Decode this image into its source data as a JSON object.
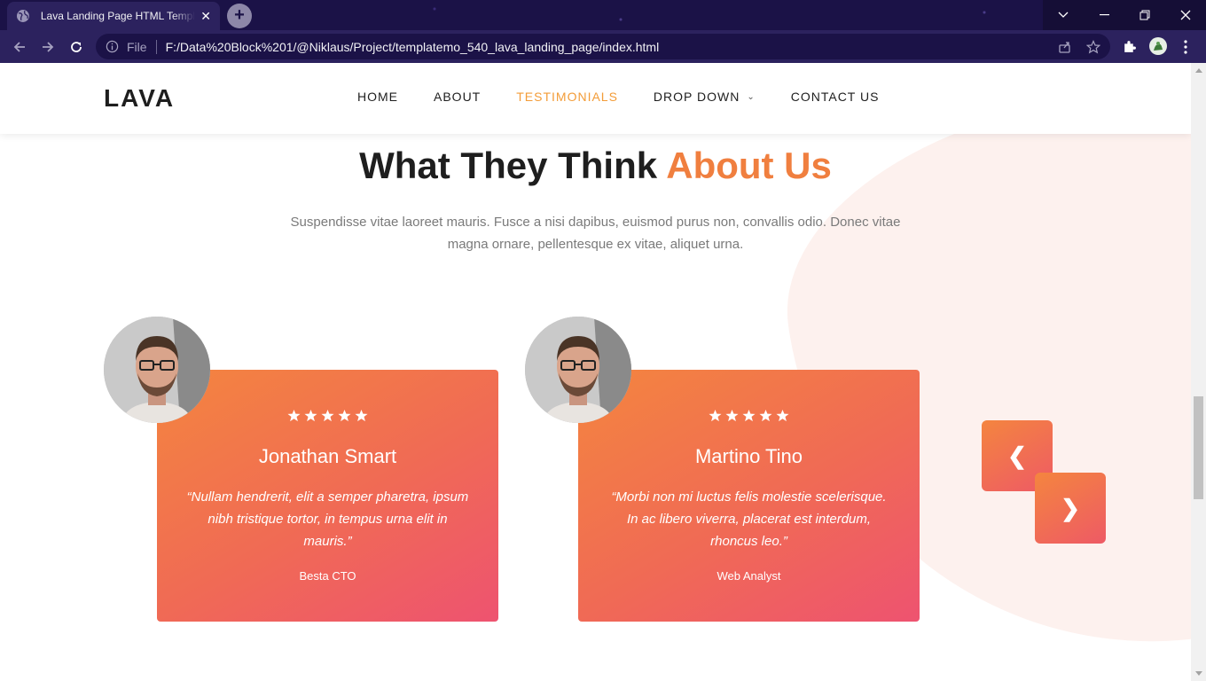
{
  "browser": {
    "tab_title": "Lava Landing Page HTML Template",
    "url_scheme_label": "File",
    "url": "F:/Data%20Block%201/@Niklaus/Project/templatemo_540_lava_landing_page/index.html"
  },
  "site": {
    "logo": "LAVA",
    "nav": [
      {
        "label": "HOME",
        "active": false
      },
      {
        "label": "ABOUT",
        "active": false
      },
      {
        "label": "TESTIMONIALS",
        "active": true
      },
      {
        "label": "DROP DOWN",
        "active": false,
        "has_dropdown": true
      },
      {
        "label": "CONTACT US",
        "active": false
      }
    ],
    "accent_color": "#f39c38"
  },
  "section": {
    "title_main": "What They Think",
    "title_accent": "About Us",
    "subtitle": "Suspendisse vitae laoreet mauris. Fusce a nisi dapibus, euismod purus non, convallis odio. Donec vitae magna ornare, pellentesque ex vitae, aliquet urna."
  },
  "testimonials": [
    {
      "name": "Jonathan Smart",
      "rating": 5,
      "quote": "“Nullam hendrerit, elit a semper pharetra, ipsum nibh tristique tortor, in tempus urna elit in mauris.”",
      "role": "Besta CTO"
    },
    {
      "name": "Martino Tino",
      "rating": 5,
      "quote": "“Morbi non mi luctus felis molestie scelerisque. In ac libero viverra, placerat est interdum, rhoncus leo.”",
      "role": "Web Analyst"
    }
  ],
  "carousel": {
    "prev_label": "❮",
    "next_label": "❯"
  }
}
